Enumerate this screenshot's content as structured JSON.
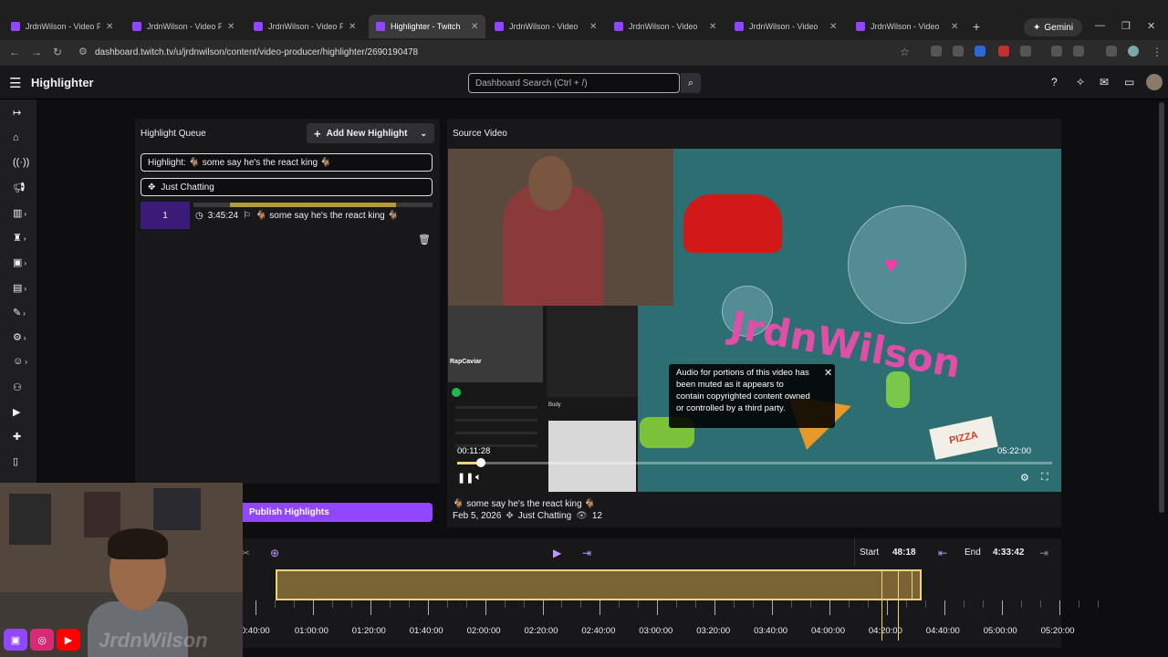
{
  "browser": {
    "tabs": [
      {
        "label": "JrdnWilson - Video Pro",
        "active": false
      },
      {
        "label": "JrdnWilson - Video Pro",
        "active": false
      },
      {
        "label": "JrdnWilson - Video Pro",
        "active": false
      },
      {
        "label": "Highlighter - Twitch",
        "active": true
      },
      {
        "label": "JrdnWilson - Video",
        "active": false
      },
      {
        "label": "JrdnWilson - Video",
        "active": false
      },
      {
        "label": "JrdnWilson - Video",
        "active": false
      },
      {
        "label": "JrdnWilson - Video",
        "active": false
      }
    ],
    "gemini_label": "Gemini",
    "url": "dashboard.twitch.tv/u/jrdnwilson/content/video-producer/highlighter/2690190478"
  },
  "header": {
    "title": "Highlighter",
    "search_placeholder": "Dashboard Search (Ctrl + /)"
  },
  "queue": {
    "title": "Highlight Queue",
    "add_label": "Add New Highlight",
    "highlight_field": "Highlight: 🐐 some say he's the react king 🐐",
    "category_field": "Just Chatting",
    "clip_number": "1",
    "clip_time": "3:45:24",
    "clip_title": "🐐 some say he's the react king 🐐",
    "publish_label": "Publish Highlights"
  },
  "source": {
    "title": "Source Video",
    "tooltip": "Audio for portions of this video has been muted as it appears to contain copyrighted content owned or controlled by a third party.",
    "current_time": "00:11:28",
    "total_time": "05:22:00",
    "progress": 0.04,
    "video_title": "🐐 some say he's the react king 🐐",
    "date": "Feb 5, 2026",
    "category": "Just Chatting",
    "views": "12",
    "overlay_logo": "JrdnWilson",
    "pizza_box": "PIZZA",
    "playlist_name": "RapCaviar",
    "track_label": "Body"
  },
  "timeline": {
    "start_label": "Start",
    "start_value": "48:18",
    "end_label": "End",
    "end_value": "4:33:42",
    "times": [
      "0:40:00",
      "01:00:00",
      "01:20:00",
      "01:40:00",
      "02:00:00",
      "02:20:00",
      "02:40:00",
      "03:00:00",
      "03:20:00",
      "03:40:00",
      "04:00:00",
      "04:20:00",
      "04:40:00",
      "05:00:00",
      "05:20:00"
    ]
  },
  "webcam": {
    "brand": "JrdnWilson"
  },
  "colors": {
    "accent": "#9147ff",
    "highlight_gold": "#efd27a",
    "background": "#0e0e10",
    "panel": "#18181b"
  }
}
